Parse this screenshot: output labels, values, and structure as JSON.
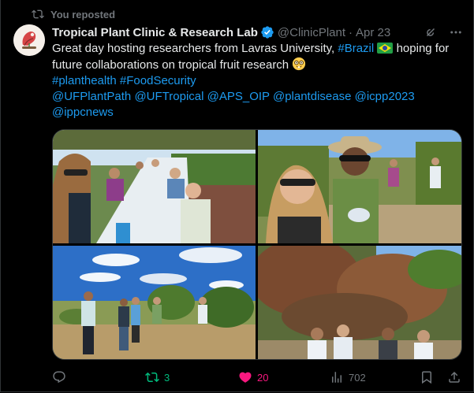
{
  "repost_banner": {
    "label": "You reposted"
  },
  "author": {
    "name": "Tropical Plant Clinic & Research Lab",
    "handle": "@ClinicPlant",
    "separator": "·",
    "date": "Apr 23",
    "verified": true
  },
  "tweet": {
    "line1_prefix": "Great day hosting researchers from Lavras University,",
    "line1_hashtag": "#Brazil",
    "line1_suffix": "hoping for",
    "line2": "future collaborations on tropical fruit research",
    "hashtag_planthealth": "#planthealth",
    "hashtag_foodsecurity": "#FoodSecurity",
    "mention_ufplantpath": "@UFPlantPath",
    "mention_uftropical": "@UFTropical",
    "mention_aps_oip": "@APS_OIP",
    "mention_plantdisease": "@plantdisease",
    "mention_icpp2023": "@icpp2023",
    "mention_ippcnews": "@ippcnews"
  },
  "media": {
    "photos": [
      {
        "icon": "group-lunch-photo"
      },
      {
        "icon": "selfie-orchard-photo"
      },
      {
        "icon": "field-walk-photo"
      },
      {
        "icon": "group-under-trees-photo"
      }
    ]
  },
  "actions": {
    "reply_count": "",
    "repost_count": "3",
    "like_count": "20",
    "views_count": "702"
  },
  "colors": {
    "background": "#000000",
    "text": "#e7e9ea",
    "muted": "#71767b",
    "link": "#1d9bf0",
    "repost_green": "#00ba7c",
    "like_pink": "#f91880"
  }
}
